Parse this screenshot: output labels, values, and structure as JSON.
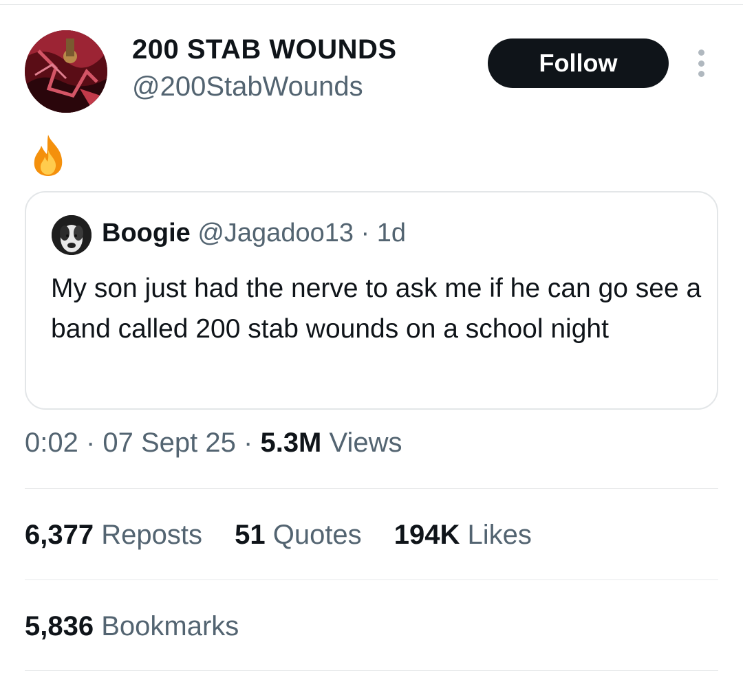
{
  "author": {
    "display_name": "200 STAB WOUNDS",
    "handle": "@200StabWounds"
  },
  "follow_label": "Follow",
  "tweet": {
    "emoji": "🔥",
    "icon": "fire-emoji"
  },
  "quoted": {
    "name": "Boogie",
    "meta": "@Jagadoo13 · 1d",
    "text": "My son just had the nerve to ask me if he can go see a band called 200 stab wounds on a school night"
  },
  "timestamp": {
    "time_date": "0:02 · 07 Sept 25 · ",
    "views_count": "5.3M",
    "views_label": " Views"
  },
  "stats": {
    "reposts_count": "6,377",
    "reposts_label": " Reposts",
    "quotes_count": "51",
    "quotes_label": " Quotes",
    "likes_count": "194K",
    "likes_label": " Likes",
    "bookmarks_count": "5,836",
    "bookmarks_label": " Bookmarks"
  },
  "colors": {
    "text_primary": "#0f1419",
    "text_secondary": "#536471",
    "button_bg": "#0f1419",
    "divider": "#e7e9ea"
  }
}
